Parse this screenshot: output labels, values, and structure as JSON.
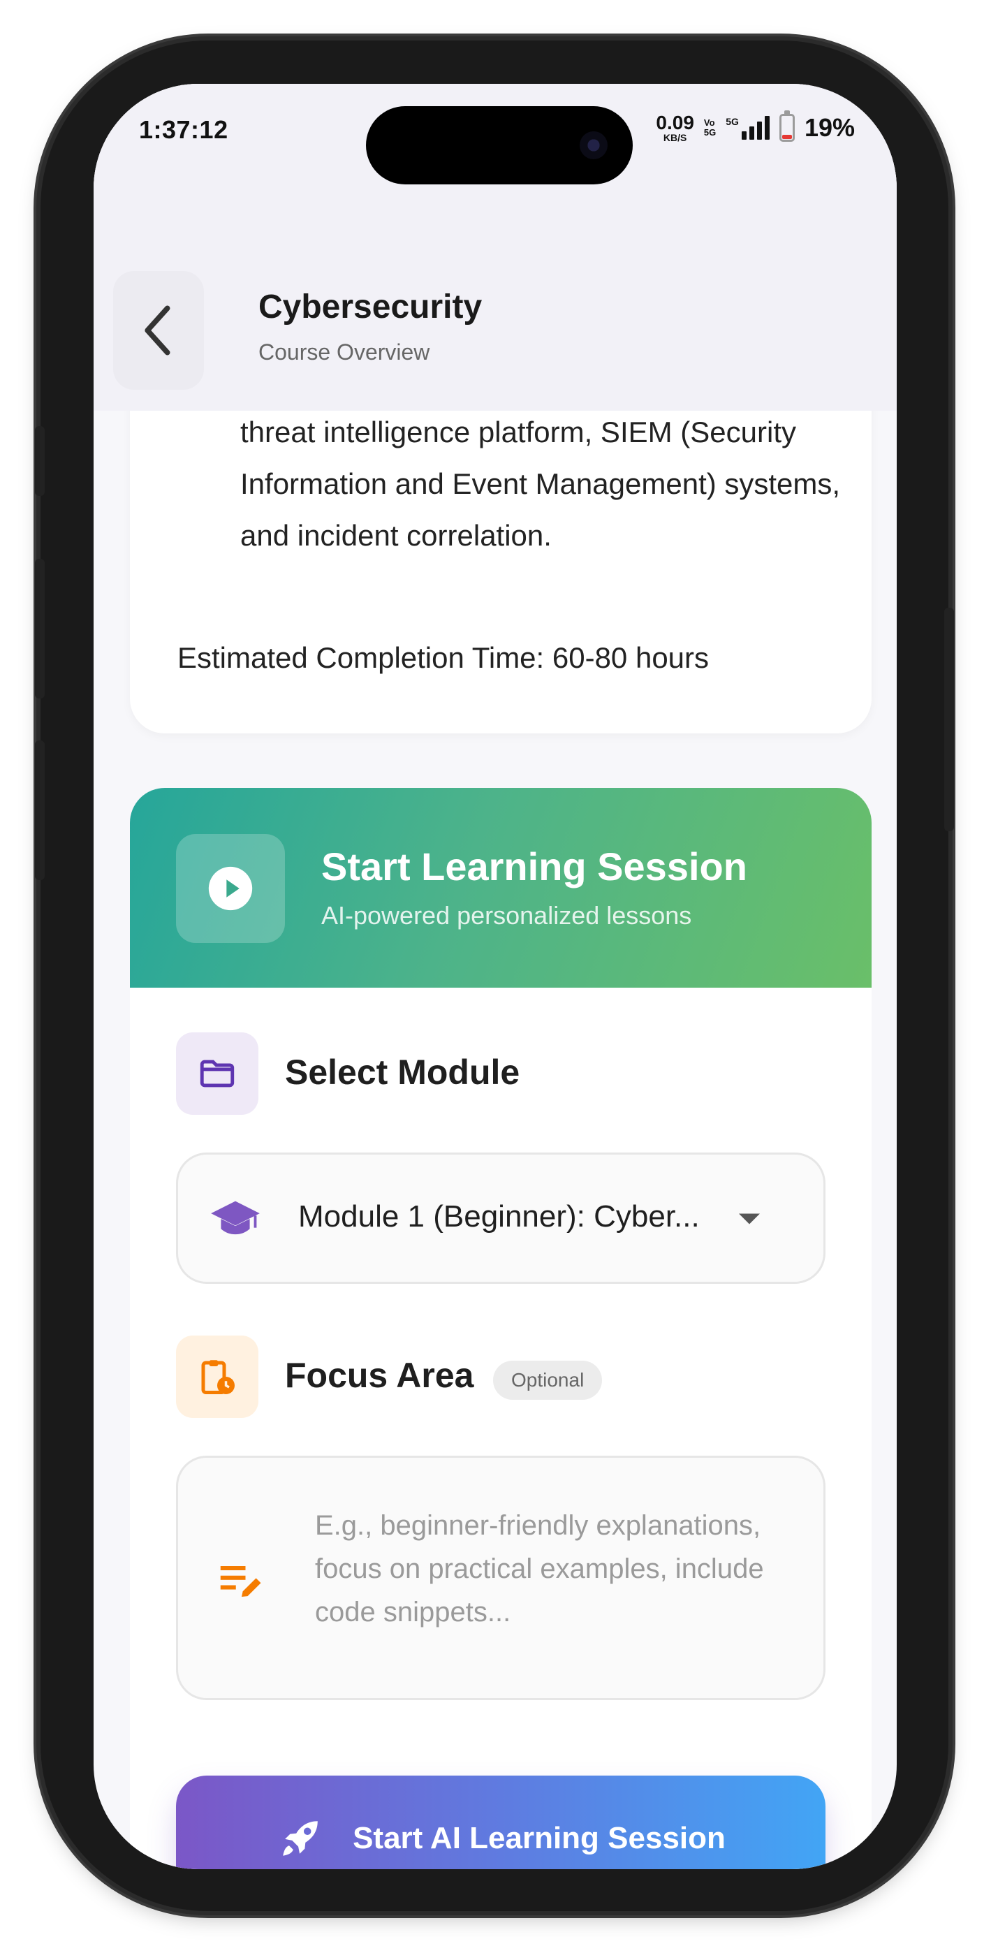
{
  "status_bar": {
    "time": "1:37:12",
    "speed_value": "0.09",
    "speed_unit": "KB/S",
    "net_label_1": "Vo",
    "net_label_2": "5G",
    "signal_label": "5G",
    "battery_percent": "19%",
    "battery_level": 0.19
  },
  "header": {
    "title": "Cybersecurity",
    "subtitle": "Course Overview",
    "back_icon": "chevron-left-icon"
  },
  "overview": {
    "description": "threat intelligence platform, SIEM (Security Information and Event Management) systems, and incident correlation.",
    "completion": "Estimated Completion Time: 60-80 hours"
  },
  "session": {
    "title": "Start Learning Session",
    "subtitle": "AI-powered personalized lessons",
    "play_icon": "play-icon",
    "gradient_colors": [
      "#26a69a",
      "#6abf69"
    ]
  },
  "module": {
    "label": "Select Module",
    "icon": "folder-icon",
    "icon_color": "#5e35b1",
    "selected": "Module 1 (Beginner): Cyber...",
    "select_icon": "graduation-cap-icon"
  },
  "focus": {
    "label": "Focus Area",
    "badge": "Optional",
    "icon": "clipboard-clock-icon",
    "icon_color": "#f57c00",
    "placeholder": "E.g., beginner-friendly explanations, focus on practical examples, include code snippets..."
  },
  "cta": {
    "label": "Start AI Learning Session",
    "icon": "rocket-icon",
    "gradient_colors": [
      "#7b57c7",
      "#42a5f5"
    ]
  }
}
